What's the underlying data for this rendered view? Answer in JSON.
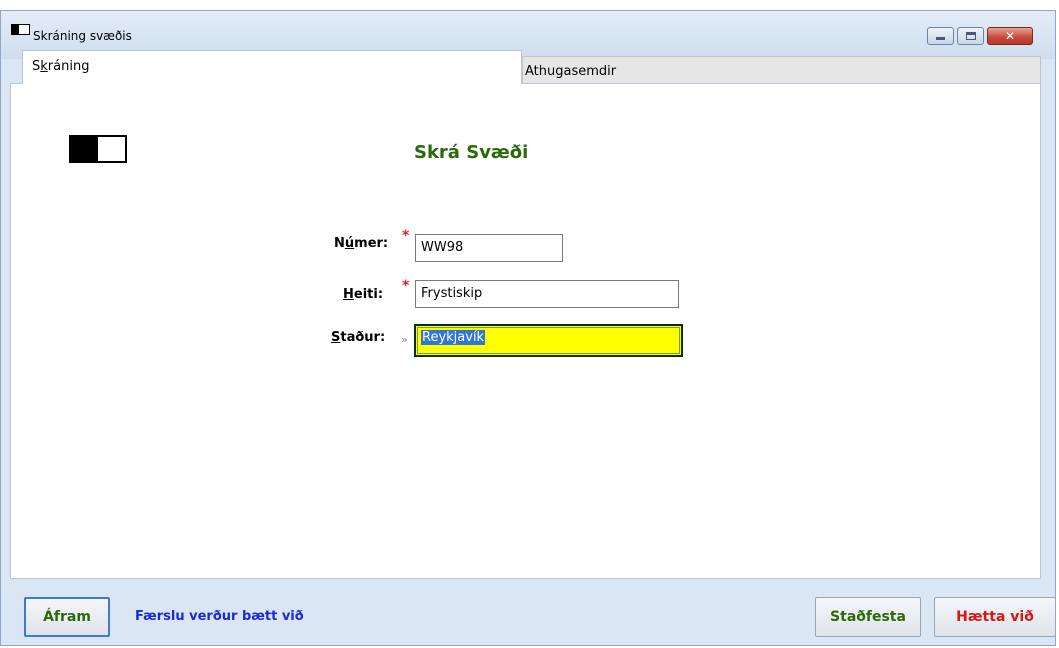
{
  "window": {
    "title": "Skráning svæðis",
    "close_glyph": "✕"
  },
  "tabs": [
    {
      "label_pre": "S",
      "label_accel": "k",
      "label_post": "ráning",
      "active": true
    },
    {
      "label": "Athugasemdir",
      "active": false
    }
  ],
  "form": {
    "heading": "Skrá Svæði",
    "fields": [
      {
        "label_pre": "N",
        "label_accel": "ú",
        "label_post": "mer:",
        "marker": "*",
        "value": "WW98",
        "required": true
      },
      {
        "label_pre": "",
        "label_accel": "H",
        "label_post": "eiti:",
        "marker": "*",
        "value": "Frystiskip",
        "required": true
      },
      {
        "label_pre": "",
        "label_accel": "S",
        "label_post": "taður:",
        "marker": "»",
        "value": "Reykjavík",
        "focused": true
      }
    ]
  },
  "footer": {
    "continue_label": "Áfram",
    "status": "Færslu verður bætt við",
    "confirm_label": "Staðfesta",
    "cancel_label": "Hætta við"
  },
  "colors": {
    "accent_green": "#2b6a0a",
    "status_blue": "#1a2ad8",
    "cancel_red": "#d41818",
    "focus_yellow": "#ffff00"
  }
}
